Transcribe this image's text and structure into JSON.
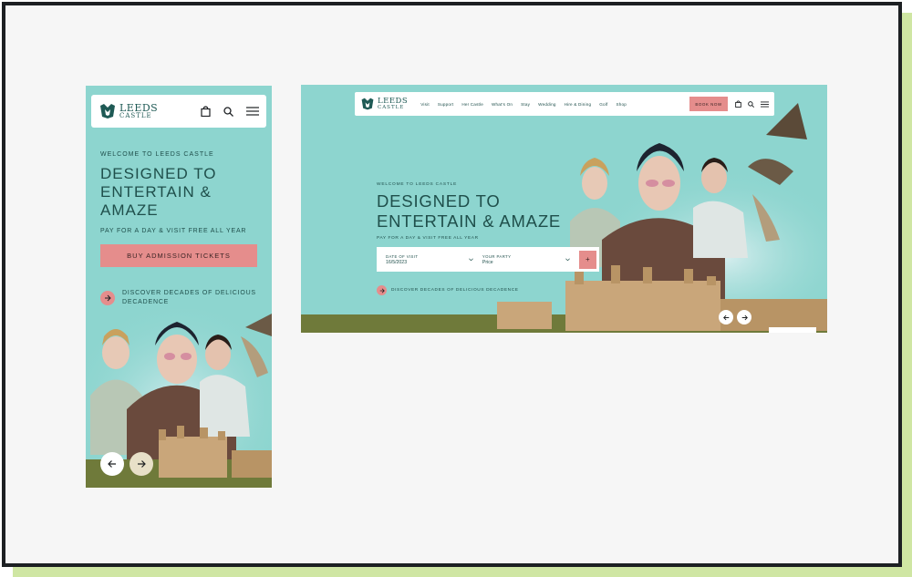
{
  "brand": {
    "name_line1": "LEEDS",
    "name_line2": "CASTLE"
  },
  "colors": {
    "teal": "#8dd5cf",
    "accent": "#e58d8c",
    "ink": "#1f4f4b",
    "frame_border": "#1d2023",
    "frame_shadow": "#cfe6a3"
  },
  "mobile": {
    "welcome": "WELCOME TO LEEDS CASTLE",
    "title_lines": [
      "DESIGNED TO",
      "ENTERTAIN &",
      "AMAZE"
    ],
    "pay": "PAY FOR A DAY & VISIT FREE ALL YEAR",
    "cta": "BUY ADMISSION TICKETS",
    "discover_lines": [
      "DISCOVER DECADES OF DELICIOUS",
      "DECADENCE"
    ],
    "icons": [
      "bag-icon",
      "search-icon",
      "menu-icon"
    ]
  },
  "desktop": {
    "nav": [
      "Visit",
      "Support",
      "Her Castle",
      "What's On",
      "Stay",
      "Wedding",
      "Hire & Dining",
      "Golf",
      "Shop"
    ],
    "book_now": "BOOK NOW",
    "welcome": "WELCOME TO LEEDS CASTLE",
    "title_lines": [
      "DESIGNED TO",
      "ENTERTAIN & AMAZE"
    ],
    "pay": "PAY FOR A DAY & VISIT FREE ALL YEAR",
    "form": {
      "date_label": "DATE OF VISIT",
      "date_value": "16/5/2023",
      "party_label": "YOUR PARTY",
      "party_value": "Price",
      "submit": "+"
    },
    "discover": "DISCOVER DECADES OF DELICIOUS DECADENCE"
  }
}
